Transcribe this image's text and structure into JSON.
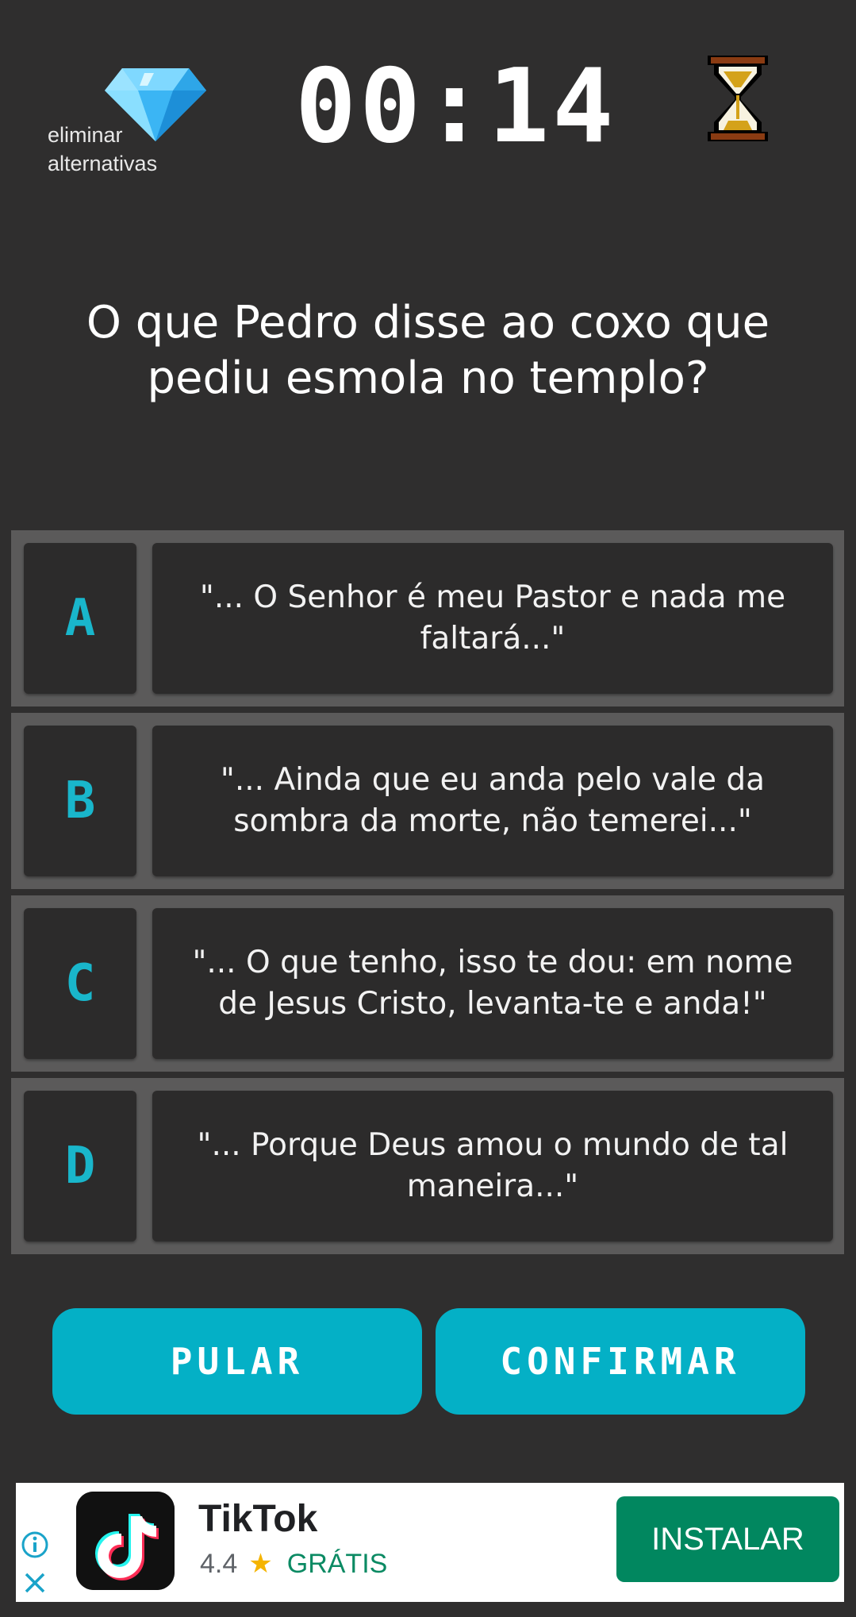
{
  "header": {
    "power_up_label_line1": "eliminar",
    "power_up_label_line2": "alternativas",
    "timer": "00:14"
  },
  "question": "O que Pedro disse ao coxo que pediu esmola no templo?",
  "answers": [
    {
      "letter": "A",
      "text": "\"... O Senhor é meu Pastor e nada me faltará...\""
    },
    {
      "letter": "B",
      "text": "\"... Ainda que eu anda pelo vale da sombra da morte, não temerei...\""
    },
    {
      "letter": "C",
      "text": "\"... O que tenho, isso te dou: em nome de Jesus Cristo, levanta-te e anda!\""
    },
    {
      "letter": "D",
      "text": "\"... Porque Deus amou o mundo de tal maneira...\""
    }
  ],
  "buttons": {
    "skip": "PULAR",
    "confirm": "CONFIRMAR"
  },
  "ad": {
    "app_name": "TikTok",
    "rating": "4.4",
    "star": "★",
    "price": "GRÁTIS",
    "install_label": "INSTALAR"
  },
  "colors": {
    "background": "#2f2e2e",
    "accent": "#04b0c6",
    "letter": "#19b6cb",
    "install": "#01875f"
  },
  "icons": {
    "power_up": "diamond-icon",
    "time": "hourglass-icon",
    "ad_info": "info-icon",
    "ad_close": "close-icon"
  }
}
